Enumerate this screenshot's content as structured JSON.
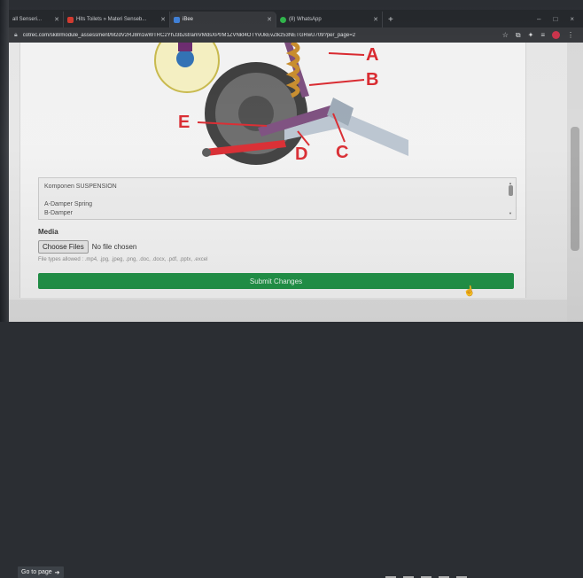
{
  "browser": {
    "tabs": [
      {
        "title": "all Senseri...",
        "active": false
      },
      {
        "title": "Hits Toilets » Materi Senseb...",
        "active": false
      },
      {
        "title": "iBee",
        "active": true
      },
      {
        "title": "(8) WhatsApp",
        "active": false
      }
    ],
    "new_tab_label": "+",
    "url": "cotrec.com/skill/module_assessment/M2dV2RJ8m1wWTRC2YhJ3bJstramVMdsXPt/M1ZVNkt4OTYvUkEvZlkz53NETGRwU709?per_page=2",
    "window_controls": [
      "–",
      "□",
      "×"
    ]
  },
  "figure": {
    "labels": [
      "A",
      "B",
      "C",
      "D",
      "E"
    ],
    "accent_color": "#d8262c"
  },
  "question": {
    "lines": [
      "Komponen SUSPENSION",
      "",
      "A-Damper Spring",
      "B-Damper"
    ]
  },
  "media": {
    "label": "Media",
    "choose_button": "Choose Files",
    "no_file": "No file chosen",
    "file_types": "File types allowed : .mp4, .jpg, .jpeg, .png, .doc, .docx, .pdf, .pptx, .excel"
  },
  "submit_label": "Submit Changes",
  "submit_color": "#1f9146",
  "goto_label": "Go to page"
}
